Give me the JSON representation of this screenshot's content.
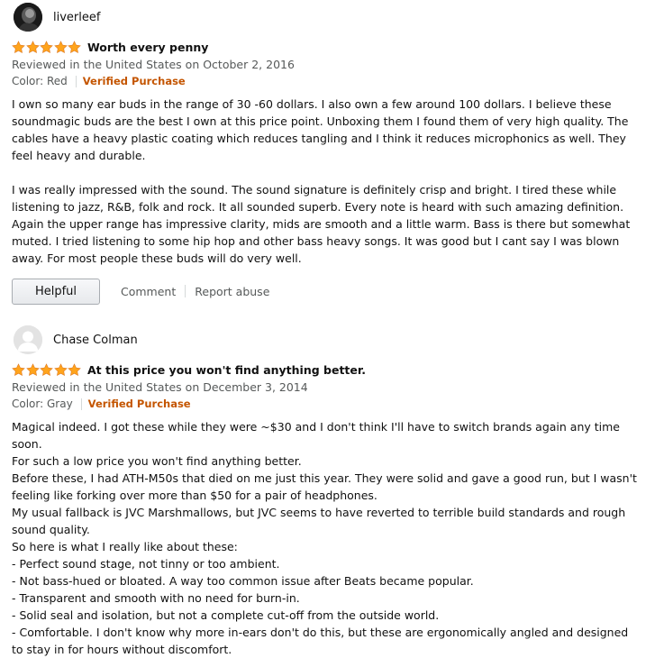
{
  "reviews": [
    {
      "author": "liverleef",
      "rating": 5,
      "title": "Worth every penny",
      "date_line": "Reviewed in the United States on October 2, 2016",
      "color": "Color: Red",
      "verified": "Verified Purchase",
      "paragraphs": [
        "I own so many ear buds in the range of 30 -60 dollars. I also own a few around 100 dollars. I believe these soundmagic buds are the best I own at this price point. Unboxing them I found them of very high quality. The cables have a heavy plastic coating which reduces tangling and I think it reduces microphonics as well. They feel heavy and durable.",
        "I was really impressed with the sound. The sound signature is definitely crisp and bright. I tired these while listening to jazz, R&B, folk and rock. It all sounded superb. Every note is heard with such amazing definition. Again the upper range has impressive clarity, mids are smooth and a little warm. Bass is there but somewhat muted. I tried listening to some hip hop and other bass heavy songs. It was good but I cant say I was blown away. For most people these buds will do very well."
      ],
      "actions": {
        "helpful": "Helpful",
        "comment": "Comment",
        "report": "Report abuse"
      }
    },
    {
      "author": "Chase Colman",
      "rating": 5,
      "title": "At this price you won't find anything better.",
      "date_line": "Reviewed in the United States on December 3, 2014",
      "color": "Color: Gray",
      "verified": "Verified Purchase",
      "lines": [
        "Magical indeed. I got these while they were ~$30 and I don't think I'll have to switch brands again any time soon.",
        "For such a low price you won't find anything better.",
        "Before these, I had ATH-M50s that died on me just this year. They were solid and gave a good run, but I wasn't feeling like forking over more than $50 for a pair of headphones.",
        "My usual fallback is JVC Marshmallows, but JVC seems to have reverted to terrible build standards and rough sound quality.",
        "So here is what I really like about these:",
        "- Perfect sound stage, not tinny or too ambient.",
        "- Not bass-hued or bloated. A way too common issue after Beats became popular.",
        "- Transparent and smooth with no need for burn-in.",
        "- Solid seal and isolation, but not a complete cut-off from the outside world.",
        "- Comfortable. I don't know why more in-ears don't do this, but these are ergonomically angled and designed to stay in for hours without discomfort."
      ]
    }
  ],
  "colors": {
    "star": "#ffa41c",
    "verified": "#c45500",
    "meta": "#565959"
  },
  "icons": {
    "star": "star-icon",
    "avatar_default": "default-avatar-icon"
  }
}
